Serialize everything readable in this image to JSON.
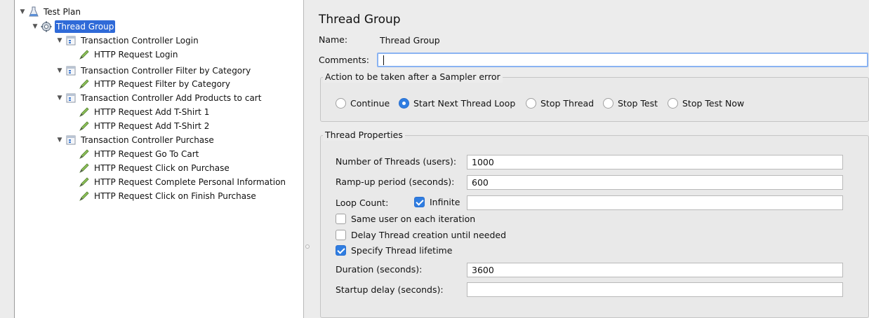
{
  "tree": {
    "items": [
      {
        "label": "Test Plan",
        "icon": "flask-icon",
        "expanded": true,
        "selected": false
      },
      {
        "label": "Thread Group",
        "icon": "gear-icon",
        "expanded": true,
        "selected": true
      },
      {
        "label": "Transaction Controller Login",
        "icon": "controller-icon",
        "expanded": true
      },
      {
        "label": "HTTP Request Login",
        "icon": "sampler-pen-icon"
      },
      {
        "label": "Transaction Controller Filter by Category",
        "icon": "controller-icon",
        "expanded": true
      },
      {
        "label": "HTTP Request Filter by Category",
        "icon": "sampler-pen-icon"
      },
      {
        "label": "Transaction Controller Add Products to cart",
        "icon": "controller-icon",
        "expanded": true
      },
      {
        "label": "HTTP Request Add T-Shirt 1",
        "icon": "sampler-pen-icon"
      },
      {
        "label": "HTTP Request Add T-Shirt 2",
        "icon": "sampler-pen-icon"
      },
      {
        "label": "Transaction Controller Purchase",
        "icon": "controller-icon",
        "expanded": true
      },
      {
        "label": "HTTP Request Go To Cart",
        "icon": "sampler-pen-icon"
      },
      {
        "label": "HTTP Request Click on Purchase",
        "icon": "sampler-pen-icon"
      },
      {
        "label": "HTTP Request Complete Personal Information",
        "icon": "sampler-pen-icon"
      },
      {
        "label": "HTTP Request Click on Finish Purchase",
        "icon": "sampler-pen-icon"
      }
    ]
  },
  "panel": {
    "title": "Thread Group",
    "name_label": "Name:",
    "name_value": "Thread Group",
    "comments_label": "Comments:",
    "comments_value": ""
  },
  "action": {
    "title": "Action to be taken after a Sampler error",
    "options": [
      {
        "label": "Continue",
        "selected": false
      },
      {
        "label": "Start Next Thread Loop",
        "selected": true
      },
      {
        "label": "Stop Thread",
        "selected": false
      },
      {
        "label": "Stop Test",
        "selected": false
      },
      {
        "label": "Stop Test Now",
        "selected": false
      }
    ]
  },
  "props": {
    "title": "Thread Properties",
    "threads_label": "Number of Threads (users):",
    "threads_value": "1000",
    "rampup_label": "Ramp-up period (seconds):",
    "rampup_value": "600",
    "loop_label": "Loop Count:",
    "infinite_label": "Infinite",
    "infinite_checked": true,
    "loop_value": "",
    "same_user_label": "Same user on each iteration",
    "same_user_checked": false,
    "delay_label": "Delay Thread creation until needed",
    "delay_checked": false,
    "lifetime_label": "Specify Thread lifetime",
    "lifetime_checked": true,
    "duration_label": "Duration (seconds):",
    "duration_value": "3600",
    "startup_label": "Startup delay (seconds):",
    "startup_value": ""
  },
  "colors": {
    "selection": "#2f6ad8",
    "accent": "#2f7de1",
    "focus": "#8ab3f2"
  }
}
